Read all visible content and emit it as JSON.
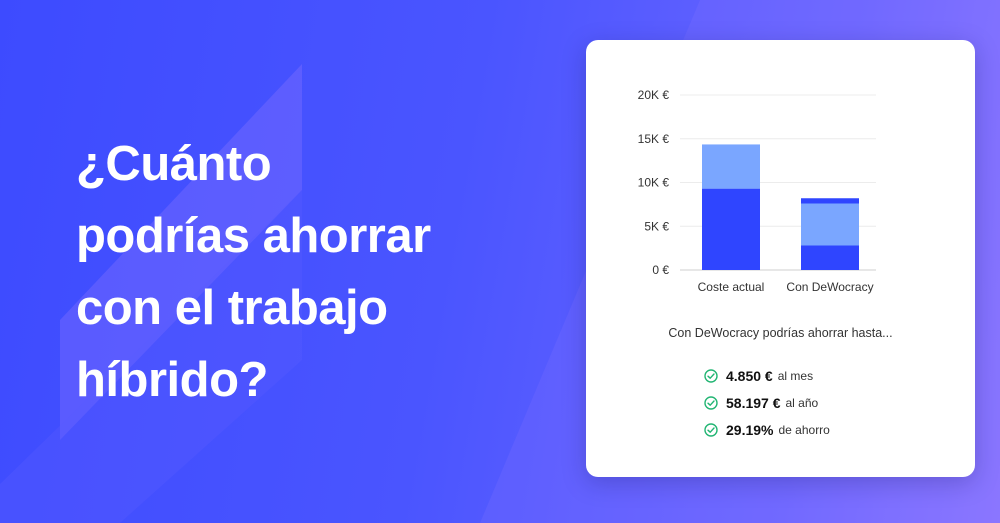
{
  "headline": [
    "¿Cuánto",
    "podrías ahorrar",
    "con el trabajo",
    "híbrido?"
  ],
  "colors": {
    "bar_dark": "#2f45ff",
    "bar_light": "#7aa6ff",
    "check": "#22b573"
  },
  "chart_data": {
    "type": "bar",
    "stacked": true,
    "categories": [
      "Coste actual",
      "Con DeWocracy"
    ],
    "series": [
      {
        "values": [
          9300,
          2800
        ],
        "color": "#2f45ff"
      },
      {
        "values": [
          5050,
          4800
        ],
        "color": "#7aa6ff"
      },
      {
        "values": [
          0,
          600
        ],
        "color": "#2f45ff"
      }
    ],
    "y_ticks": [
      "0 €",
      "5K €",
      "10K €",
      "15K €",
      "20K €"
    ],
    "ylim": [
      0,
      20000
    ],
    "grid": true,
    "title": "",
    "xlabel": "",
    "ylabel": ""
  },
  "summary": {
    "intro": "Con DeWocracy podrías ahorrar hasta...",
    "items": [
      {
        "value": "4.850 €",
        "label": "al mes"
      },
      {
        "value": "58.197 €",
        "label": "al año"
      },
      {
        "value": "29.19%",
        "label": "de ahorro"
      }
    ]
  }
}
